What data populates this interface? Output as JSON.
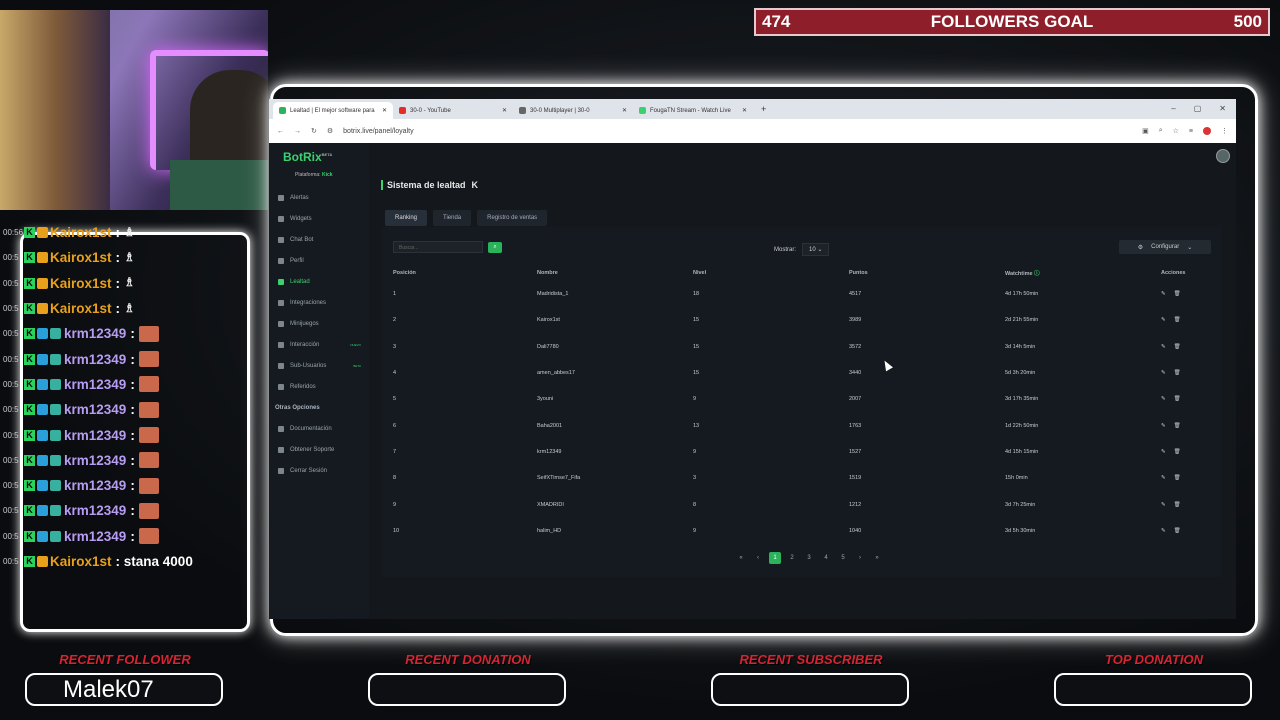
{
  "goal": {
    "current": "474",
    "label": "FOLLOWERS GOAL",
    "target": "500"
  },
  "browser": {
    "tabs": [
      {
        "title": "Lealtad | El mejor software para"
      },
      {
        "title": "30-0 - YouTube"
      },
      {
        "title": "30-0 Multiplayer | 30-0"
      },
      {
        "title": "FougaTN Stream - Watch Live"
      }
    ],
    "url": "botrix.live/panel/loyalty"
  },
  "app": {
    "logo": "BotRix",
    "logo_badge": "BETA",
    "platform_label": "Plataforma:",
    "platform_value": "Kick",
    "nav": [
      {
        "label": "Alertas"
      },
      {
        "label": "Widgets"
      },
      {
        "label": "Chat Bot"
      },
      {
        "label": "Perfil"
      },
      {
        "label": "Lealtad"
      },
      {
        "label": "Integraciones"
      },
      {
        "label": "Minijuegos"
      },
      {
        "label": "Interacción",
        "badge": "NUEVO"
      },
      {
        "label": "Sub-Usuarios",
        "badge": "BETA"
      },
      {
        "label": "Referidos"
      }
    ],
    "other_section": "Otras Opciones",
    "other": [
      {
        "label": "Documentación"
      },
      {
        "label": "Obtener Soporte"
      },
      {
        "label": "Cerrar Sesión"
      }
    ],
    "page_title": "Sistema de lealtad",
    "subtabs": [
      "Ranking",
      "Tienda",
      "Registro de ventas"
    ],
    "search_placeholder": "Buscar...",
    "show_label": "Mostrar:",
    "show_value": "10",
    "configure": "Configurar",
    "columns": [
      "Posición",
      "Nombre",
      "Nivel",
      "Puntos",
      "Watchtime",
      "Acciones"
    ],
    "rows": [
      [
        "1",
        "Madridista_1",
        "18",
        "4517",
        "4d 17h 50min"
      ],
      [
        "2",
        "Kairox1st",
        "15",
        "3989",
        "2d 21h 55min"
      ],
      [
        "3",
        "Dali7780",
        "15",
        "3572",
        "3d 14h 5min"
      ],
      [
        "4",
        "amen_abbes17",
        "15",
        "3440",
        "5d 3h 20min"
      ],
      [
        "5",
        "3youni",
        "9",
        "2007",
        "3d 17h 35min"
      ],
      [
        "6",
        "Baha2001",
        "13",
        "1763",
        "1d 22h 50min"
      ],
      [
        "7",
        "krm12349",
        "9",
        "1527",
        "4d 15h 15min"
      ],
      [
        "8",
        "SeifXTimse7_Fifa",
        "3",
        "1519",
        "15h 0min"
      ],
      [
        "9",
        "XMADRIDI",
        "8",
        "1212",
        "3d 7h 25min"
      ],
      [
        "10",
        "halim_HD",
        "9",
        "1040",
        "3d 5h 30min"
      ]
    ],
    "pages": [
      "1",
      "2",
      "3",
      "4",
      "5"
    ]
  },
  "chat": [
    {
      "ts": "00:56",
      "user": "Kairox1st",
      "badge": "crown",
      "text": ":"
    },
    {
      "ts": "00:5",
      "user": "Kairox1st",
      "badge": "crown",
      "text": ":"
    },
    {
      "ts": "00:5",
      "user": "Kairox1st",
      "badge": "crown",
      "text": ":"
    },
    {
      "ts": "00:5",
      "user": "Kairox1st",
      "badge": "crown",
      "text": ":"
    },
    {
      "ts": "00:5",
      "user": "krm12349",
      "badge": "sub",
      "text": ":"
    },
    {
      "ts": "00:5",
      "user": "krm12349",
      "badge": "sub",
      "text": ":"
    },
    {
      "ts": "00:5",
      "user": "krm12349",
      "badge": "sub",
      "text": ":"
    },
    {
      "ts": "00:5",
      "user": "krm12349",
      "badge": "sub",
      "text": ":"
    },
    {
      "ts": "00:5",
      "user": "krm12349",
      "badge": "sub",
      "text": ":"
    },
    {
      "ts": "00:5",
      "user": "krm12349",
      "badge": "sub",
      "text": ":"
    },
    {
      "ts": "00:5",
      "user": "krm12349",
      "badge": "sub",
      "text": ":"
    },
    {
      "ts": "00:5",
      "user": "krm12349",
      "badge": "sub",
      "text": ":"
    },
    {
      "ts": "00:5",
      "user": "krm12349",
      "badge": "sub",
      "text": ":"
    },
    {
      "ts": "00:5",
      "user": "Kairox1st",
      "badge": "crown",
      "text": ": stana 4000"
    }
  ],
  "bottom": [
    {
      "title": "RECENT FOLLOWER",
      "value": "Malek07"
    },
    {
      "title": "RECENT DONATION",
      "value": ""
    },
    {
      "title": "RECENT SUBSCRIBER",
      "value": ""
    },
    {
      "title": "TOP DONATION",
      "value": ""
    }
  ],
  "colors": {
    "accent": "#3bd16f",
    "goal_bar": "#8f1e2b",
    "chat_orange": "#e9a11b",
    "chat_purple": "#b79cf2",
    "bottom_title": "#d82433"
  }
}
